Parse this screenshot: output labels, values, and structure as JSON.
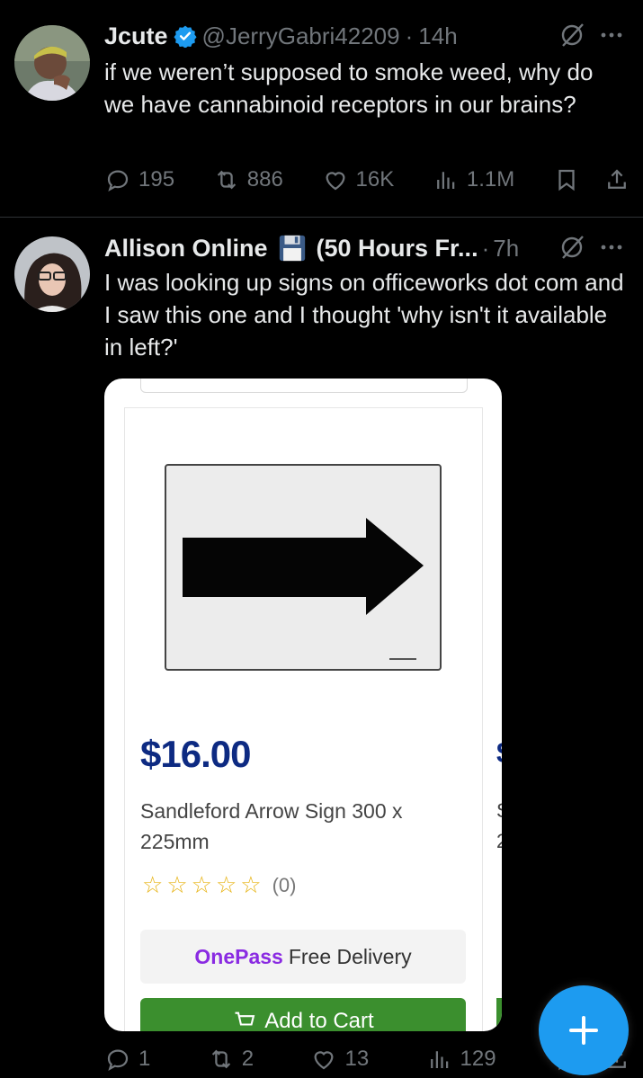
{
  "tweets": [
    {
      "name": "Jcute",
      "handle": "@JerryGabri42209",
      "separator": "·",
      "time": "14h",
      "text": "if we weren’t supposed to smoke weed, why do we have cannabinoid receptors in our brains?",
      "replies": "195",
      "retweets": "886",
      "likes": "16K",
      "views": "1.1M"
    },
    {
      "name": "Allison Online",
      "name_suffix": "(50 Hours Fr...",
      "separator": "·",
      "time": "7h",
      "text": "I was looking up signs on officeworks dot com and I saw this one and I thought 'why isn't it available in left?'",
      "replies": "1",
      "retweets": "2",
      "likes": "13",
      "views": "129"
    }
  ],
  "product": {
    "price": "$16.00",
    "name": "Sandleford Arrow Sign 300 x 225mm",
    "reviews": "(0)",
    "onepass": "OnePass",
    "delivery": "Free Delivery",
    "cart_label": "Add to Cart",
    "peek_price": "$",
    "peek_name_1": "S",
    "peek_name_2": "2"
  },
  "colors": {
    "background": "#000000",
    "accent": "#1d9bf0",
    "muted": "#71767b",
    "price": "#0d2a82",
    "cart": "#3b8f2e"
  },
  "fab_label": "+"
}
